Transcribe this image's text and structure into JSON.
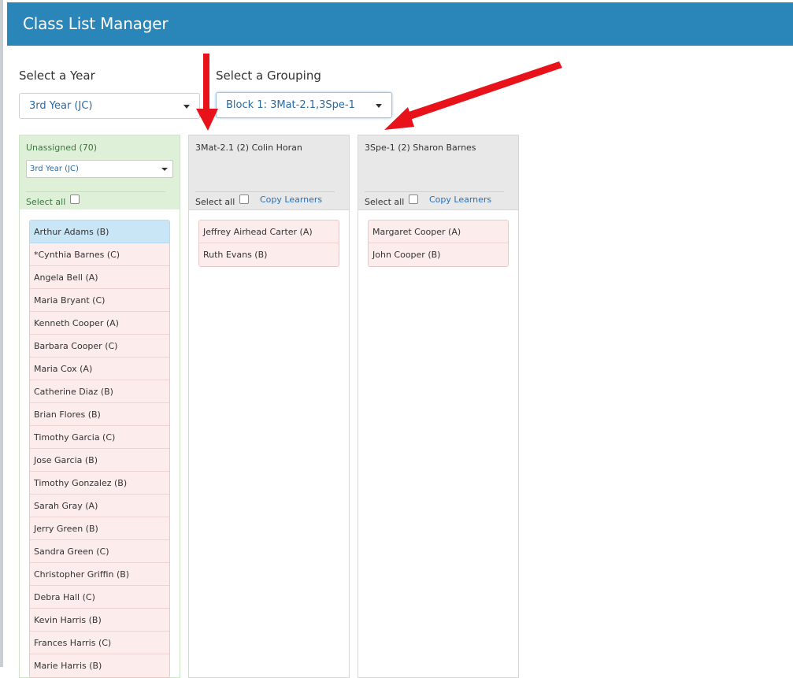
{
  "app": {
    "title": "Class List Manager"
  },
  "filters": {
    "year_label": "Select a Year",
    "year_value": "3rd Year (JC)",
    "grouping_label": "Select a Grouping",
    "grouping_value": "Block 1: 3Mat-2.1,3Spe-1"
  },
  "unassigned": {
    "title": "Unassigned (70)",
    "filter_value": "3rd Year (JC)",
    "select_all_label": "Select all",
    "students": [
      "Arthur Adams (B)",
      "*Cynthia Barnes (C)",
      "Angela Bell (A)",
      "Maria Bryant (C)",
      "Kenneth Cooper (A)",
      "Barbara Cooper (C)",
      "Maria Cox (A)",
      "Catherine Diaz (B)",
      "Brian Flores (B)",
      "Timothy Garcia (C)",
      "Jose Garcia (B)",
      "Timothy Gonzalez (B)",
      "Sarah Gray (A)",
      "Jerry Green (B)",
      "Sandra Green (C)",
      "Christopher Griffin (B)",
      "Debra Hall (C)",
      "Kevin Harris (B)",
      "Frances Harris (C)",
      "Marie Harris (B)"
    ]
  },
  "groups": [
    {
      "title": "3Mat-2.1 (2) Colin Horan",
      "select_all_label": "Select all",
      "copy_label": "Copy Learners",
      "students": [
        "Jeffrey Airhead Carter (A)",
        "Ruth Evans (B)"
      ]
    },
    {
      "title": "3Spe-1 (2) Sharon Barnes",
      "select_all_label": "Select all",
      "copy_label": "Copy Learners",
      "students": [
        "Margaret Cooper (A)",
        "John Cooper (B)"
      ]
    }
  ],
  "colors": {
    "header": "#2a85b8",
    "unassigned_panel": "#dff0d8",
    "student_row": "#fcecec",
    "selected_row": "#c9e6f7",
    "annotation_arrow": "#e8121b"
  }
}
